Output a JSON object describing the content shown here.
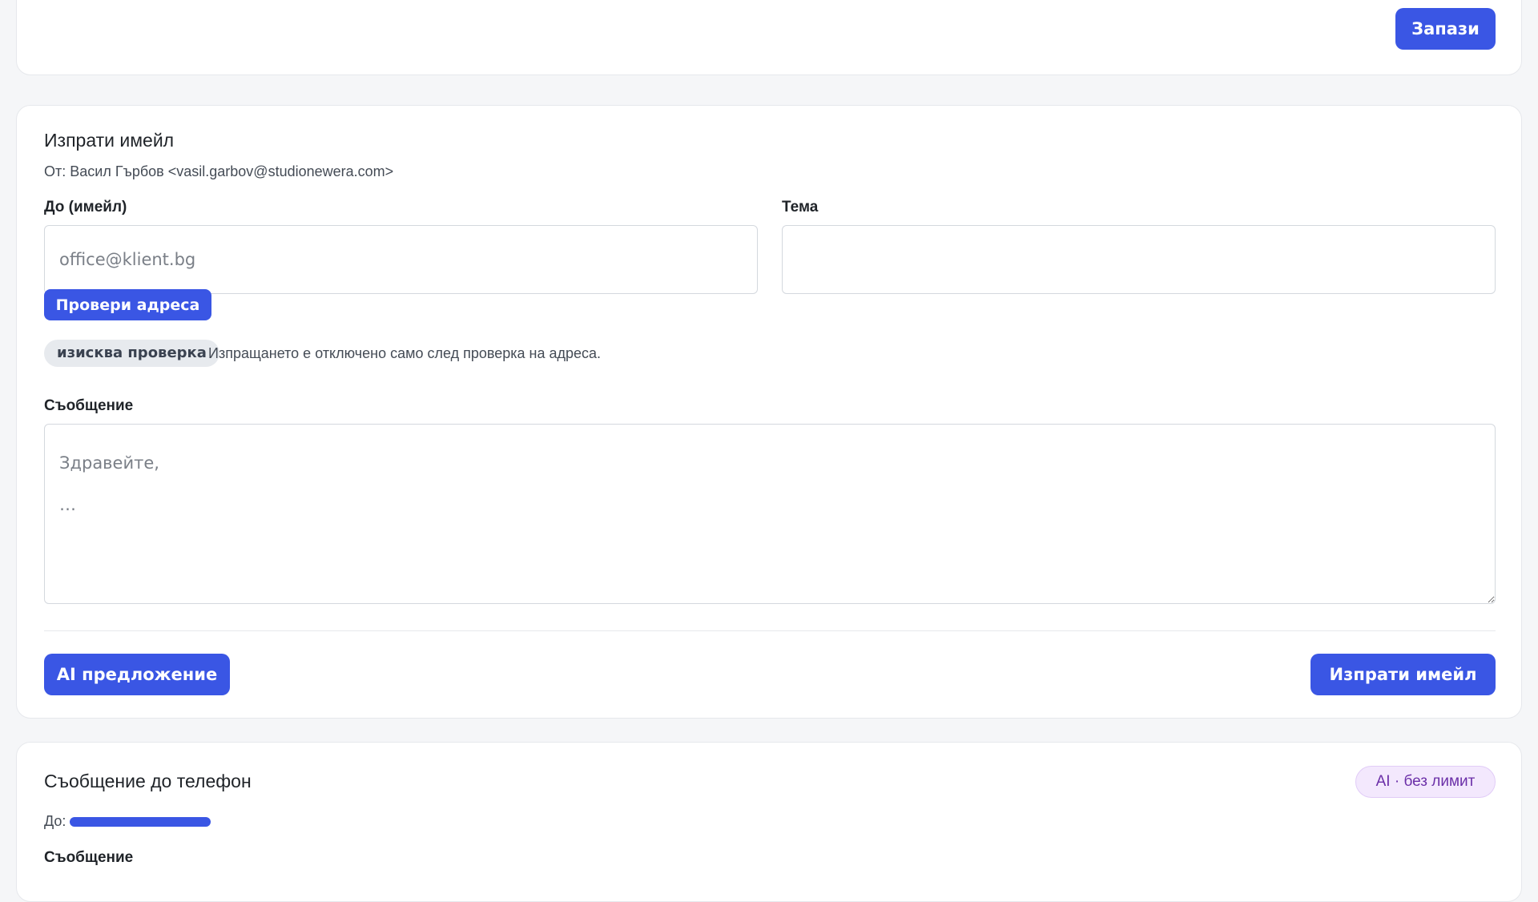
{
  "top_card": {
    "save_label": "Запази"
  },
  "email_card": {
    "title": "Изпрати имейл",
    "from_prefix": "От:",
    "from_value": "Васил Гърбов <vasil.garbov@studionewera.com>",
    "to_label": "До (имейл)",
    "to_placeholder": "office@klient.bg",
    "subject_label": "Тема",
    "subject_value": "",
    "verify_button": "Провери адреса",
    "status_badge": "изисква проверка",
    "status_note": "Изпращането е отключено само след проверка на адреса.",
    "message_label": "Съобщение",
    "message_placeholder": "Здравейте,\n…",
    "ai_button": "AI предложение",
    "send_button": "Изпрати имейл"
  },
  "phone_card": {
    "title": "Съобщение до телефон",
    "ai_badge": "AI · без лимит",
    "to_prefix": "До:",
    "message_label": "Съобщение"
  },
  "colors": {
    "primary": "#3a56e4",
    "badge_gray_bg": "#e7eaee",
    "badge_purple_bg": "#f3e8fd",
    "badge_purple_text": "#6b2fa8"
  }
}
